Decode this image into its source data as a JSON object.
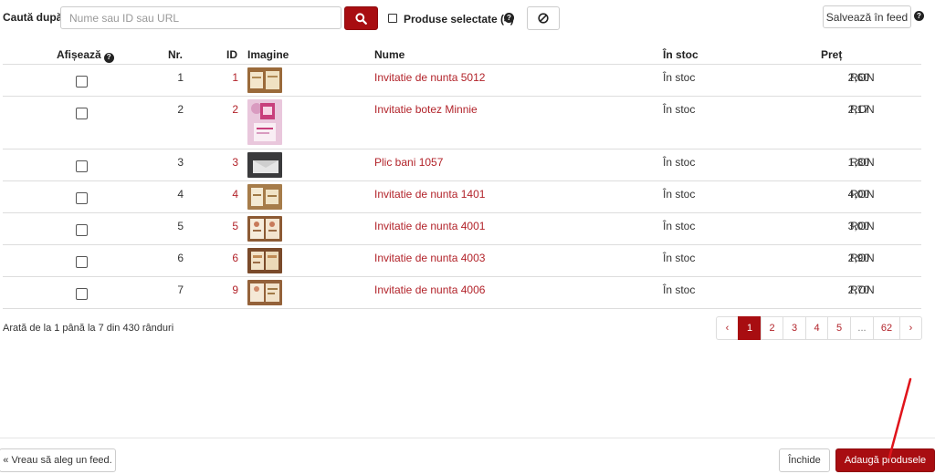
{
  "search": {
    "label": "Caută după:",
    "placeholder": "Nume sau ID sau URL",
    "value": "",
    "button_icon": "search-icon"
  },
  "selected_filter": {
    "label": "Produse selectate (4)",
    "checked": false,
    "help_icon": "question-circle-icon",
    "clear_icon": "ban-icon"
  },
  "save_feed": {
    "label": "Salvează în feed",
    "help_icon": "question-circle-icon"
  },
  "table": {
    "headers": {
      "show": "Afișează",
      "nr": "Nr.",
      "id": "ID",
      "image": "Imagine",
      "name": "Nume",
      "stock": "În stoc",
      "price": "Preț"
    },
    "rows": [
      {
        "nr": "1",
        "id": "1",
        "name": "Invitatie de nunta 5012",
        "stock": "În stoc",
        "price": "2,60",
        "currency": "RON",
        "thumb": "card-cream"
      },
      {
        "nr": "2",
        "id": "2",
        "name": "Invitatie botez Minnie",
        "stock": "În stoc",
        "price": "2,17",
        "currency": "RON",
        "thumb": "pink-tall"
      },
      {
        "nr": "3",
        "id": "3",
        "name": "Plic bani 1057",
        "stock": "În stoc",
        "price": "1,80",
        "currency": "RON",
        "thumb": "envelope-dark"
      },
      {
        "nr": "4",
        "id": "4",
        "name": "Invitatie de nunta 1401",
        "stock": "În stoc",
        "price": "4,00",
        "currency": "RON",
        "thumb": "card-cream"
      },
      {
        "nr": "5",
        "id": "5",
        "name": "Invitatie de nunta 4001",
        "stock": "În stoc",
        "price": "3,00",
        "currency": "RON",
        "thumb": "card-floral"
      },
      {
        "nr": "6",
        "id": "6",
        "name": "Invitatie de nunta 4003",
        "stock": "În stoc",
        "price": "2,90",
        "currency": "RON",
        "thumb": "card-warm"
      },
      {
        "nr": "7",
        "id": "9",
        "name": "Invitatie de nunta 4006",
        "stock": "În stoc",
        "price": "2,70",
        "currency": "RON",
        "thumb": "card-floral"
      }
    ]
  },
  "summary": "Arată de la 1 până la 7 din 430 rânduri",
  "pagination": {
    "prev": "‹",
    "pages": [
      "1",
      "2",
      "3",
      "4",
      "5",
      "...",
      "62"
    ],
    "current": "1",
    "next": "›"
  },
  "footer": {
    "back_label": "« Vreau să aleg un feed.",
    "close_label": "Închide",
    "add_label": "Adaugă produsele"
  },
  "colors": {
    "accent": "#a80d11",
    "link": "#b2232a",
    "annotation": "#e0141b"
  }
}
